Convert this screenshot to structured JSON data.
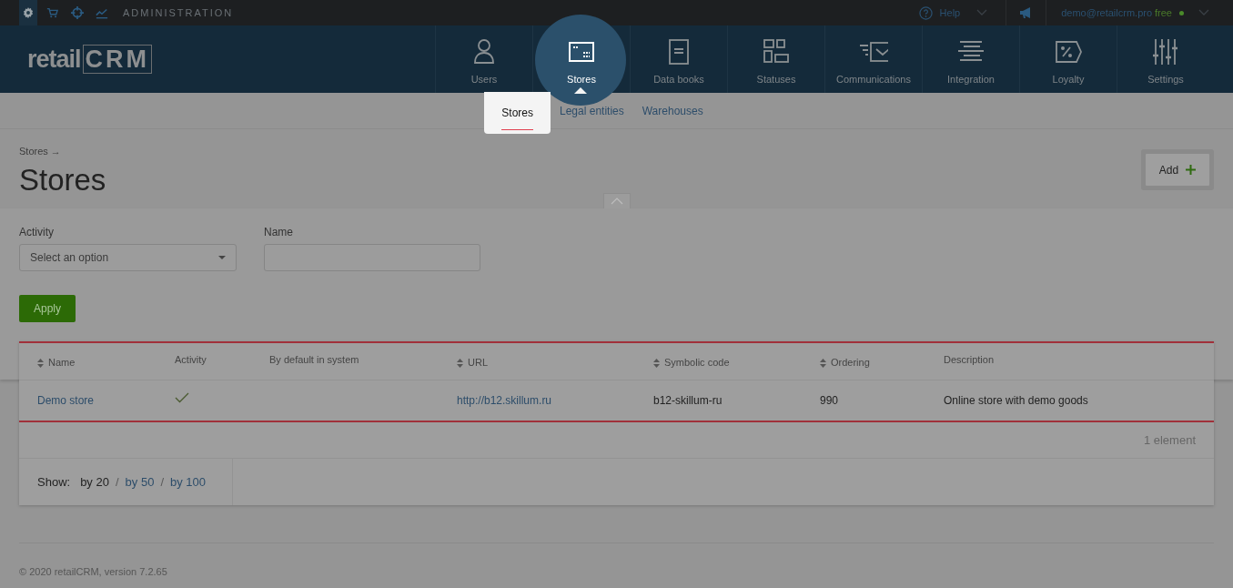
{
  "top_bar": {
    "app_icons": [
      {
        "selected": true
      },
      {
        "selected": false
      },
      {
        "selected": false
      },
      {
        "selected": false
      }
    ],
    "section_label": "ADMINISTRATION",
    "help": "Help",
    "user_email": "demo@retailcrm.pro",
    "plan": "free"
  },
  "logo": {
    "text": "retail",
    "boxed": "CRM"
  },
  "nav": [
    {
      "label": "Users",
      "selected": false
    },
    {
      "label": "Stores",
      "selected": true
    },
    {
      "label": "Data books",
      "selected": false
    },
    {
      "label": "Statuses",
      "selected": false
    },
    {
      "label": "Communications",
      "selected": false
    },
    {
      "label": "Integration",
      "selected": false
    },
    {
      "label": "Loyalty",
      "selected": false
    },
    {
      "label": "Settings",
      "selected": false
    }
  ],
  "subnav": [
    {
      "label": "Stores",
      "selected": true
    },
    {
      "label": "Legal entities",
      "selected": false
    },
    {
      "label": "Warehouses",
      "selected": false
    }
  ],
  "breadcrumb": "Stores →",
  "title": "Stores",
  "add_button": "Add",
  "filters": [
    {
      "kind": "select",
      "label": "Activity",
      "placeholder": "Select an option"
    },
    {
      "kind": "text",
      "label": "Name"
    }
  ],
  "apply_button": "Apply",
  "table": {
    "columns": [
      {
        "label": "Name",
        "sortable": true
      },
      {
        "label": "Activity",
        "sortable": false
      },
      {
        "label": "By default in system",
        "sortable": false
      },
      {
        "label": "URL",
        "sortable": true
      },
      {
        "label": "Symbolic code",
        "sortable": true
      },
      {
        "label": "Ordering",
        "sortable": true
      },
      {
        "label": "Description",
        "sortable": false
      }
    ],
    "rows": [
      {
        "name": "Demo store",
        "active": true,
        "url": "http://b12.skillum.ru",
        "code": "b12-skillum-ru",
        "ordering": "990",
        "description": "Online store with demo goods"
      }
    ]
  },
  "count": "1 element",
  "pagination": {
    "label": "Show:",
    "separator": "/",
    "options": [
      {
        "label": "by 20",
        "selected": true
      },
      {
        "label": "by 50",
        "selected": false
      },
      {
        "label": "by 100",
        "selected": false
      }
    ]
  },
  "footer": "© 2020 retailCRM, version 7.2.65"
}
